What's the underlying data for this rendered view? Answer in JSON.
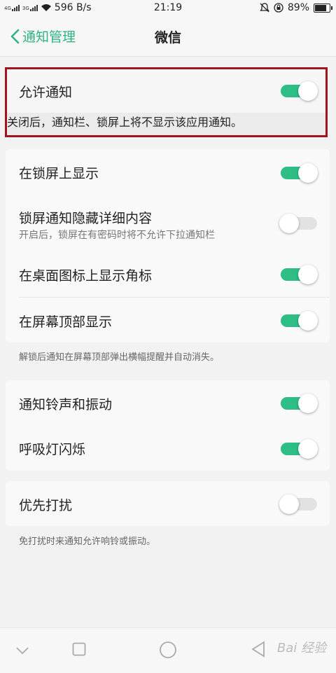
{
  "status": {
    "net1": "4G",
    "net2": "3G",
    "speed": "596 B/s",
    "time": "21:19",
    "battery": "89%",
    "battery_level": 0.89
  },
  "header": {
    "back_label": "通知管理",
    "title": "微信"
  },
  "allow": {
    "label": "允许通知",
    "note": "关闭后，通知栏、锁屏上将不显示该应用通知。",
    "on": true
  },
  "section1": {
    "rows": [
      {
        "label": "在锁屏上显示",
        "sub": "",
        "on": true
      },
      {
        "label": "锁屏通知隐藏详细内容",
        "sub": "开启后，锁屏在有密码时将不允许下拉通知栏",
        "on": false
      },
      {
        "label": "在桌面图标上显示角标",
        "sub": "",
        "on": true
      },
      {
        "label": "在屏幕顶部显示",
        "sub": "",
        "on": true
      }
    ],
    "note": "解锁后通知在屏幕顶部弹出横幅提醒并自动消失。"
  },
  "section2": {
    "rows": [
      {
        "label": "通知铃声和振动",
        "on": true
      },
      {
        "label": "呼吸灯闪烁",
        "on": true
      }
    ]
  },
  "section3": {
    "rows": [
      {
        "label": "优先打扰",
        "on": false
      }
    ],
    "note": "免打扰时来通知允许响铃或振动。"
  },
  "watermark": "Bai 经验",
  "colors": {
    "accent": "#2ebd85",
    "highlight_border": "#a0141e"
  }
}
